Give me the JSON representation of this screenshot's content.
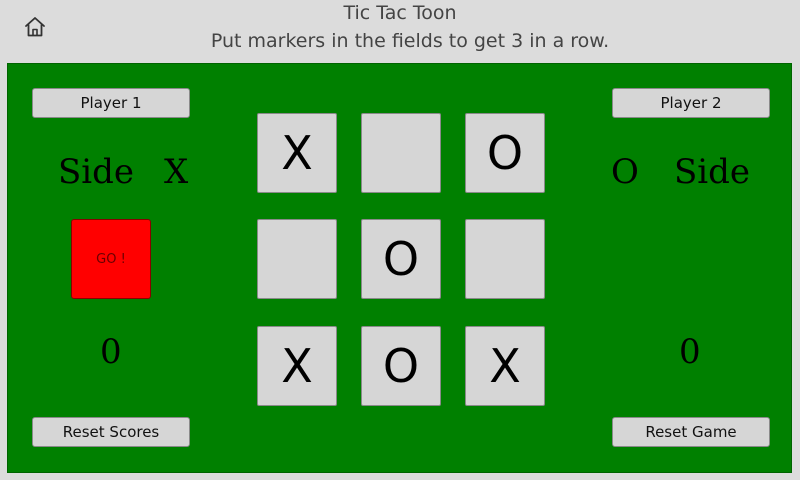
{
  "header": {
    "title": "Tic Tac Toon",
    "subtitle": "Put markers in the fields to get 3 in a row."
  },
  "players": {
    "player1": {
      "label": "Player 1",
      "side_word": "Side",
      "marker": "X",
      "score": "0"
    },
    "player2": {
      "label": "Player 2",
      "side_word": "Side",
      "marker": "O",
      "score": "0"
    }
  },
  "go_button": {
    "label": "GO !",
    "color": "#ff0000"
  },
  "controls": {
    "reset_scores": "Reset Scores",
    "reset_game": "Reset Game"
  },
  "board": {
    "cells": [
      "X",
      "",
      "O",
      "",
      "O",
      "",
      "X",
      "O",
      "X"
    ],
    "color": "#008000"
  }
}
